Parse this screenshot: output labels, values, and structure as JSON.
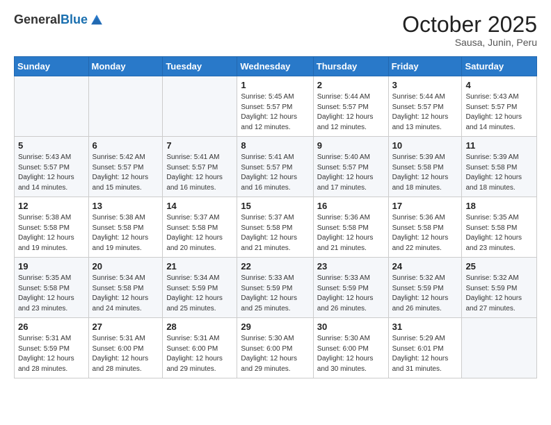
{
  "header": {
    "logo_general": "General",
    "logo_blue": "Blue",
    "month": "October 2025",
    "location": "Sausa, Junin, Peru"
  },
  "days_of_week": [
    "Sunday",
    "Monday",
    "Tuesday",
    "Wednesday",
    "Thursday",
    "Friday",
    "Saturday"
  ],
  "weeks": [
    [
      {
        "day": "",
        "info": ""
      },
      {
        "day": "",
        "info": ""
      },
      {
        "day": "",
        "info": ""
      },
      {
        "day": "1",
        "info": "Sunrise: 5:45 AM\nSunset: 5:57 PM\nDaylight: 12 hours\nand 12 minutes."
      },
      {
        "day": "2",
        "info": "Sunrise: 5:44 AM\nSunset: 5:57 PM\nDaylight: 12 hours\nand 12 minutes."
      },
      {
        "day": "3",
        "info": "Sunrise: 5:44 AM\nSunset: 5:57 PM\nDaylight: 12 hours\nand 13 minutes."
      },
      {
        "day": "4",
        "info": "Sunrise: 5:43 AM\nSunset: 5:57 PM\nDaylight: 12 hours\nand 14 minutes."
      }
    ],
    [
      {
        "day": "5",
        "info": "Sunrise: 5:43 AM\nSunset: 5:57 PM\nDaylight: 12 hours\nand 14 minutes."
      },
      {
        "day": "6",
        "info": "Sunrise: 5:42 AM\nSunset: 5:57 PM\nDaylight: 12 hours\nand 15 minutes."
      },
      {
        "day": "7",
        "info": "Sunrise: 5:41 AM\nSunset: 5:57 PM\nDaylight: 12 hours\nand 16 minutes."
      },
      {
        "day": "8",
        "info": "Sunrise: 5:41 AM\nSunset: 5:57 PM\nDaylight: 12 hours\nand 16 minutes."
      },
      {
        "day": "9",
        "info": "Sunrise: 5:40 AM\nSunset: 5:57 PM\nDaylight: 12 hours\nand 17 minutes."
      },
      {
        "day": "10",
        "info": "Sunrise: 5:39 AM\nSunset: 5:58 PM\nDaylight: 12 hours\nand 18 minutes."
      },
      {
        "day": "11",
        "info": "Sunrise: 5:39 AM\nSunset: 5:58 PM\nDaylight: 12 hours\nand 18 minutes."
      }
    ],
    [
      {
        "day": "12",
        "info": "Sunrise: 5:38 AM\nSunset: 5:58 PM\nDaylight: 12 hours\nand 19 minutes."
      },
      {
        "day": "13",
        "info": "Sunrise: 5:38 AM\nSunset: 5:58 PM\nDaylight: 12 hours\nand 19 minutes."
      },
      {
        "day": "14",
        "info": "Sunrise: 5:37 AM\nSunset: 5:58 PM\nDaylight: 12 hours\nand 20 minutes."
      },
      {
        "day": "15",
        "info": "Sunrise: 5:37 AM\nSunset: 5:58 PM\nDaylight: 12 hours\nand 21 minutes."
      },
      {
        "day": "16",
        "info": "Sunrise: 5:36 AM\nSunset: 5:58 PM\nDaylight: 12 hours\nand 21 minutes."
      },
      {
        "day": "17",
        "info": "Sunrise: 5:36 AM\nSunset: 5:58 PM\nDaylight: 12 hours\nand 22 minutes."
      },
      {
        "day": "18",
        "info": "Sunrise: 5:35 AM\nSunset: 5:58 PM\nDaylight: 12 hours\nand 23 minutes."
      }
    ],
    [
      {
        "day": "19",
        "info": "Sunrise: 5:35 AM\nSunset: 5:58 PM\nDaylight: 12 hours\nand 23 minutes."
      },
      {
        "day": "20",
        "info": "Sunrise: 5:34 AM\nSunset: 5:58 PM\nDaylight: 12 hours\nand 24 minutes."
      },
      {
        "day": "21",
        "info": "Sunrise: 5:34 AM\nSunset: 5:59 PM\nDaylight: 12 hours\nand 25 minutes."
      },
      {
        "day": "22",
        "info": "Sunrise: 5:33 AM\nSunset: 5:59 PM\nDaylight: 12 hours\nand 25 minutes."
      },
      {
        "day": "23",
        "info": "Sunrise: 5:33 AM\nSunset: 5:59 PM\nDaylight: 12 hours\nand 26 minutes."
      },
      {
        "day": "24",
        "info": "Sunrise: 5:32 AM\nSunset: 5:59 PM\nDaylight: 12 hours\nand 26 minutes."
      },
      {
        "day": "25",
        "info": "Sunrise: 5:32 AM\nSunset: 5:59 PM\nDaylight: 12 hours\nand 27 minutes."
      }
    ],
    [
      {
        "day": "26",
        "info": "Sunrise: 5:31 AM\nSunset: 5:59 PM\nDaylight: 12 hours\nand 28 minutes."
      },
      {
        "day": "27",
        "info": "Sunrise: 5:31 AM\nSunset: 6:00 PM\nDaylight: 12 hours\nand 28 minutes."
      },
      {
        "day": "28",
        "info": "Sunrise: 5:31 AM\nSunset: 6:00 PM\nDaylight: 12 hours\nand 29 minutes."
      },
      {
        "day": "29",
        "info": "Sunrise: 5:30 AM\nSunset: 6:00 PM\nDaylight: 12 hours\nand 29 minutes."
      },
      {
        "day": "30",
        "info": "Sunrise: 5:30 AM\nSunset: 6:00 PM\nDaylight: 12 hours\nand 30 minutes."
      },
      {
        "day": "31",
        "info": "Sunrise: 5:29 AM\nSunset: 6:01 PM\nDaylight: 12 hours\nand 31 minutes."
      },
      {
        "day": "",
        "info": ""
      }
    ]
  ]
}
